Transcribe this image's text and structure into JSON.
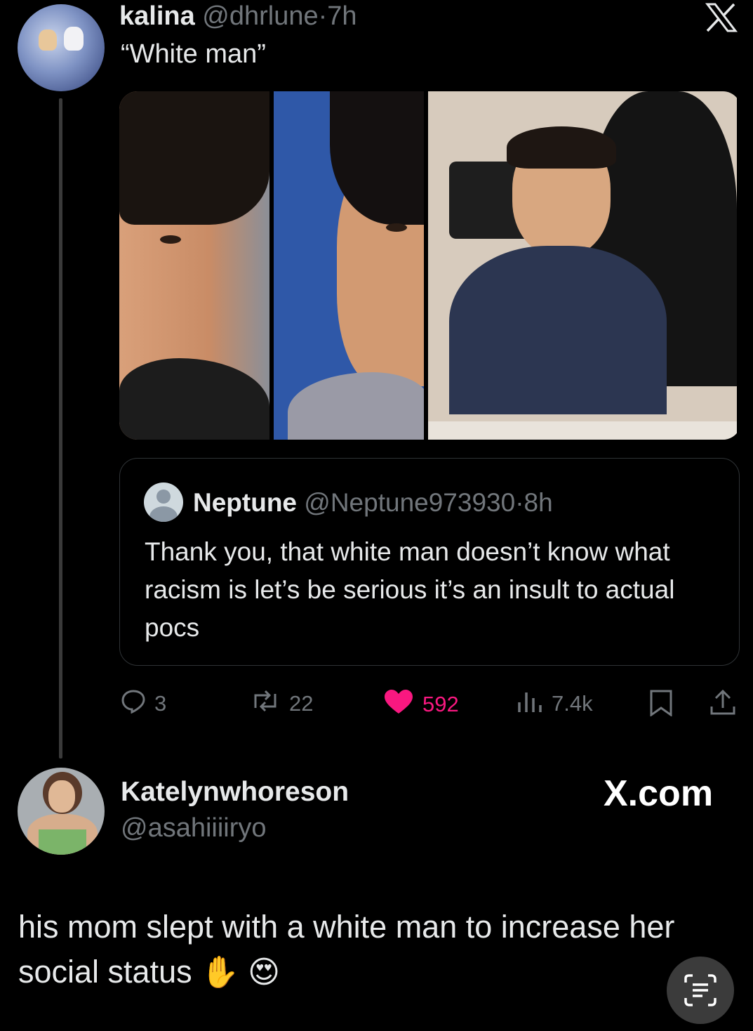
{
  "tweet": {
    "author_name": "kalina",
    "author_handle": "@dhrlune",
    "separator": "·",
    "time": "7h",
    "text": "“White man”",
    "platform_icon": "x-logo-icon"
  },
  "quoted": {
    "author_name": "Neptune",
    "author_handle": "@Neptune973930",
    "separator": "·",
    "time": "8h",
    "text": "Thank you, that white man doesn’t know what racism is let’s be serious it’s an insult to actual pocs"
  },
  "actions": {
    "replies": "3",
    "reposts": "22",
    "likes": "592",
    "views": "7.4k",
    "like_color": "#f91880"
  },
  "reply": {
    "author_name": "Katelynwhoreson",
    "author_handle": "@asahiiiiryo",
    "watermark": "X.com",
    "text": "his mom slept with a white man to increase her social status",
    "emojis": "✋ 😍"
  }
}
